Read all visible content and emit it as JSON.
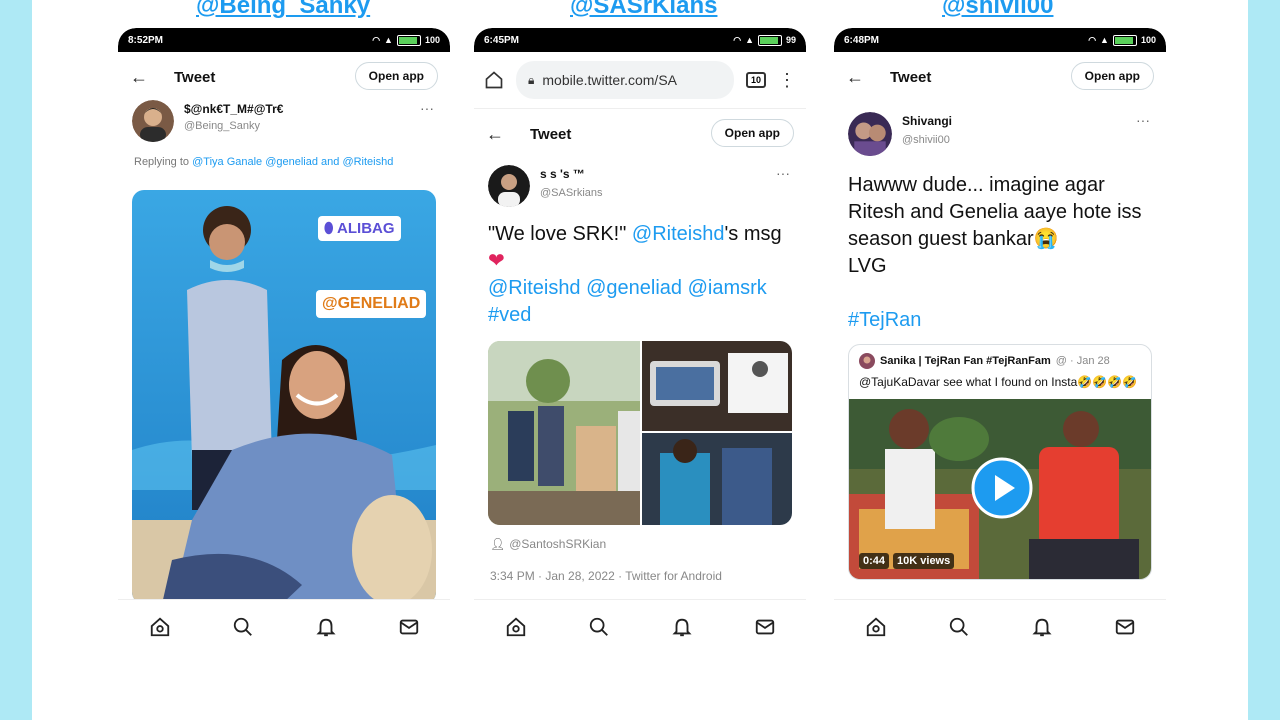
{
  "panels": [
    {
      "handle_label": "@Being_Sanky",
      "status_time": "8:52PM",
      "status_battery": "100",
      "appbar_title": "Tweet",
      "open_app_label": "Open app",
      "author_name": "$@nk€T_M#@Tr€",
      "author_handle": "@Being_Sanky",
      "replying_prefix": "Replying to ",
      "replying_names": "@Tiya Ganale @geneliad and @Riteishd",
      "sticker_location": "ALIBAG",
      "sticker_mention": "@GENELIAD"
    },
    {
      "handle_label": "@SASrKians",
      "status_time": "6:45PM",
      "status_battery": "99",
      "url": "mobile.twitter.com/SA",
      "tab_count": "10",
      "appbar_title": "Tweet",
      "open_app_label": "Open app",
      "author_name": "s   s   's ™",
      "author_handle": "@SASrkians",
      "text_line1": "\"We love SRK!\" ",
      "text_mention1": "@Riteishd",
      "text_line1_end": "'s msg",
      "text_heart": "❤",
      "text_mentions": "@Riteishd @geneliad @iamsrk",
      "text_hashtag": "#ved",
      "photo_credit": "@SantoshSRKian",
      "timestamp": "3:34 PM · Jan 28, 2022 · Twitter for Android"
    },
    {
      "handle_label": "@shivii00",
      "status_time": "6:48PM",
      "status_battery": "100",
      "appbar_title": "Tweet",
      "open_app_label": "Open app",
      "author_name": "Shivangi",
      "author_handle": "@shivii00",
      "text_main": "Hawww dude... imagine agar Ritesh and Genelia aaye hote iss season guest bankar😭",
      "text_lvg": "LVG",
      "text_hashtag": "#TejRan",
      "quote_author": "Sanika | TejRan Fan #TejRanFam",
      "quote_date": "@ · Jan 28",
      "quote_text": "@TajuKaDavar see what I found on Insta🤣🤣🤣🤣",
      "video_duration": "0:44",
      "video_views": "10K views"
    }
  ],
  "icons": [
    "back-arrow-icon",
    "home-icon",
    "search-icon",
    "bell-icon",
    "mail-icon",
    "play-icon",
    "heart-icon",
    "person-icon",
    "lock-icon",
    "kebab-icon"
  ],
  "colors": {
    "twitter_blue": "#1d9bf0",
    "page_bg": "#aee9f5"
  }
}
